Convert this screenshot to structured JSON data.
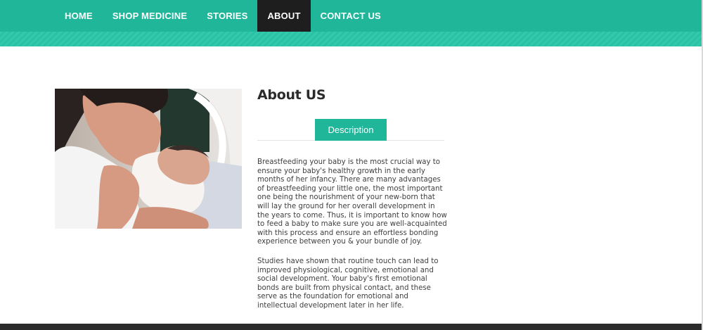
{
  "nav": {
    "items": [
      {
        "label": "HOME",
        "active": false
      },
      {
        "label": "SHOP MEDICINE",
        "active": false
      },
      {
        "label": "STORIES",
        "active": false
      },
      {
        "label": "ABOUT",
        "active": true
      },
      {
        "label": "CONTACT US",
        "active": false
      }
    ]
  },
  "colors": {
    "brand": "#1fb69a",
    "active_nav": "#1e1e1e",
    "footer": "#2b2b2b"
  },
  "hero_image": {
    "icon": "mother-holding-newborn-photo"
  },
  "about": {
    "heading": "About US",
    "tab_label": "Description",
    "paragraphs": [
      "Breastfeeding your baby is the most crucial way to ensure your baby's healthy growth in the early months of her infancy. There are many advantages of breastfeeding your little one, the most important one being the nourishment of your new-born that will lay the ground for her overall development in the years to come. Thus, it is important to know how to feed a baby to make sure you are well-acquainted with this process and ensure an effortless bonding experience between you & your bundle of joy.",
      "Studies have shown that routine touch can lead to improved physiological, cognitive, emotional and social development. Your baby's first emotional bonds are built from physical contact, and these serve as the foundation for emotional and intellectual development later in her life."
    ]
  }
}
